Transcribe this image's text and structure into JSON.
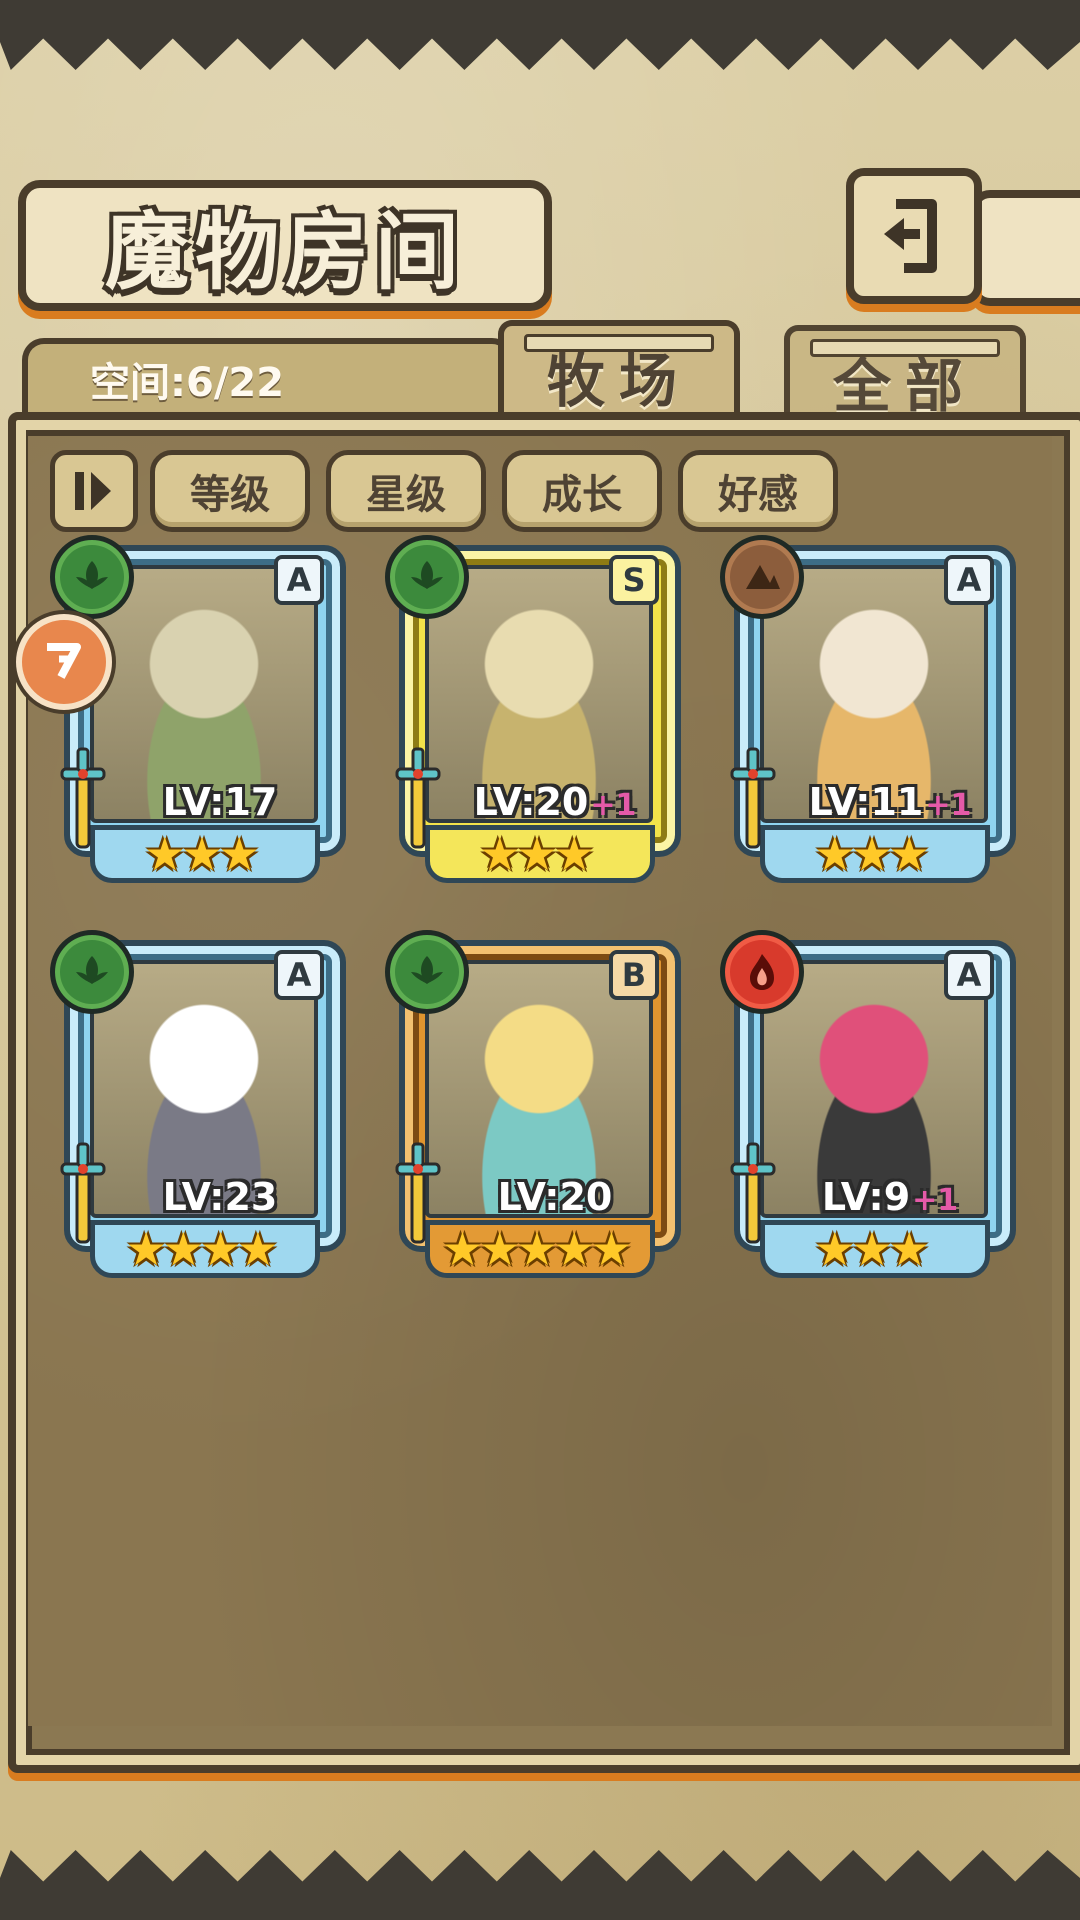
{
  "header": {
    "title": "魔物房间",
    "back_icon": "back-arrow-icon"
  },
  "panel": {
    "space_label": "空间:6/22",
    "tabs": [
      {
        "label": "牧场",
        "active": true
      },
      {
        "label": "全部",
        "active": false
      }
    ],
    "sort_buttons": [
      {
        "label": "等级"
      },
      {
        "label": "星级"
      },
      {
        "label": "成长"
      },
      {
        "label": "好感"
      }
    ]
  },
  "monsters": [
    {
      "rank": "A",
      "element": "wood",
      "level": "LV:17",
      "plus": "",
      "stars": 3,
      "frame": "blue",
      "colors": [
        "#d9d2b0",
        "#8fa36a"
      ],
      "marked": true
    },
    {
      "rank": "S",
      "element": "wood",
      "level": "LV:20",
      "plus": "+1",
      "stars": 3,
      "frame": "gold",
      "colors": [
        "#e8dcb0",
        "#c7b36e"
      ],
      "marked": false
    },
    {
      "rank": "A",
      "element": "earth",
      "level": "LV:11",
      "plus": "+1",
      "stars": 3,
      "frame": "blue",
      "colors": [
        "#f1e6d2",
        "#e6b76a"
      ],
      "marked": false
    },
    {
      "rank": "A",
      "element": "wood",
      "level": "LV:23",
      "plus": "",
      "stars": 4,
      "frame": "blue",
      "colors": [
        "#ffffff",
        "#7a7a86"
      ],
      "marked": false
    },
    {
      "rank": "B",
      "element": "wood",
      "level": "LV:20",
      "plus": "",
      "stars": 5,
      "frame": "bronze",
      "colors": [
        "#f4dc86",
        "#7cc9c4"
      ],
      "marked": false
    },
    {
      "rank": "A",
      "element": "fire",
      "level": "LV:9",
      "plus": "+1",
      "stars": 3,
      "frame": "blue",
      "colors": [
        "#e0507a",
        "#3a3a3a"
      ],
      "marked": false
    }
  ]
}
